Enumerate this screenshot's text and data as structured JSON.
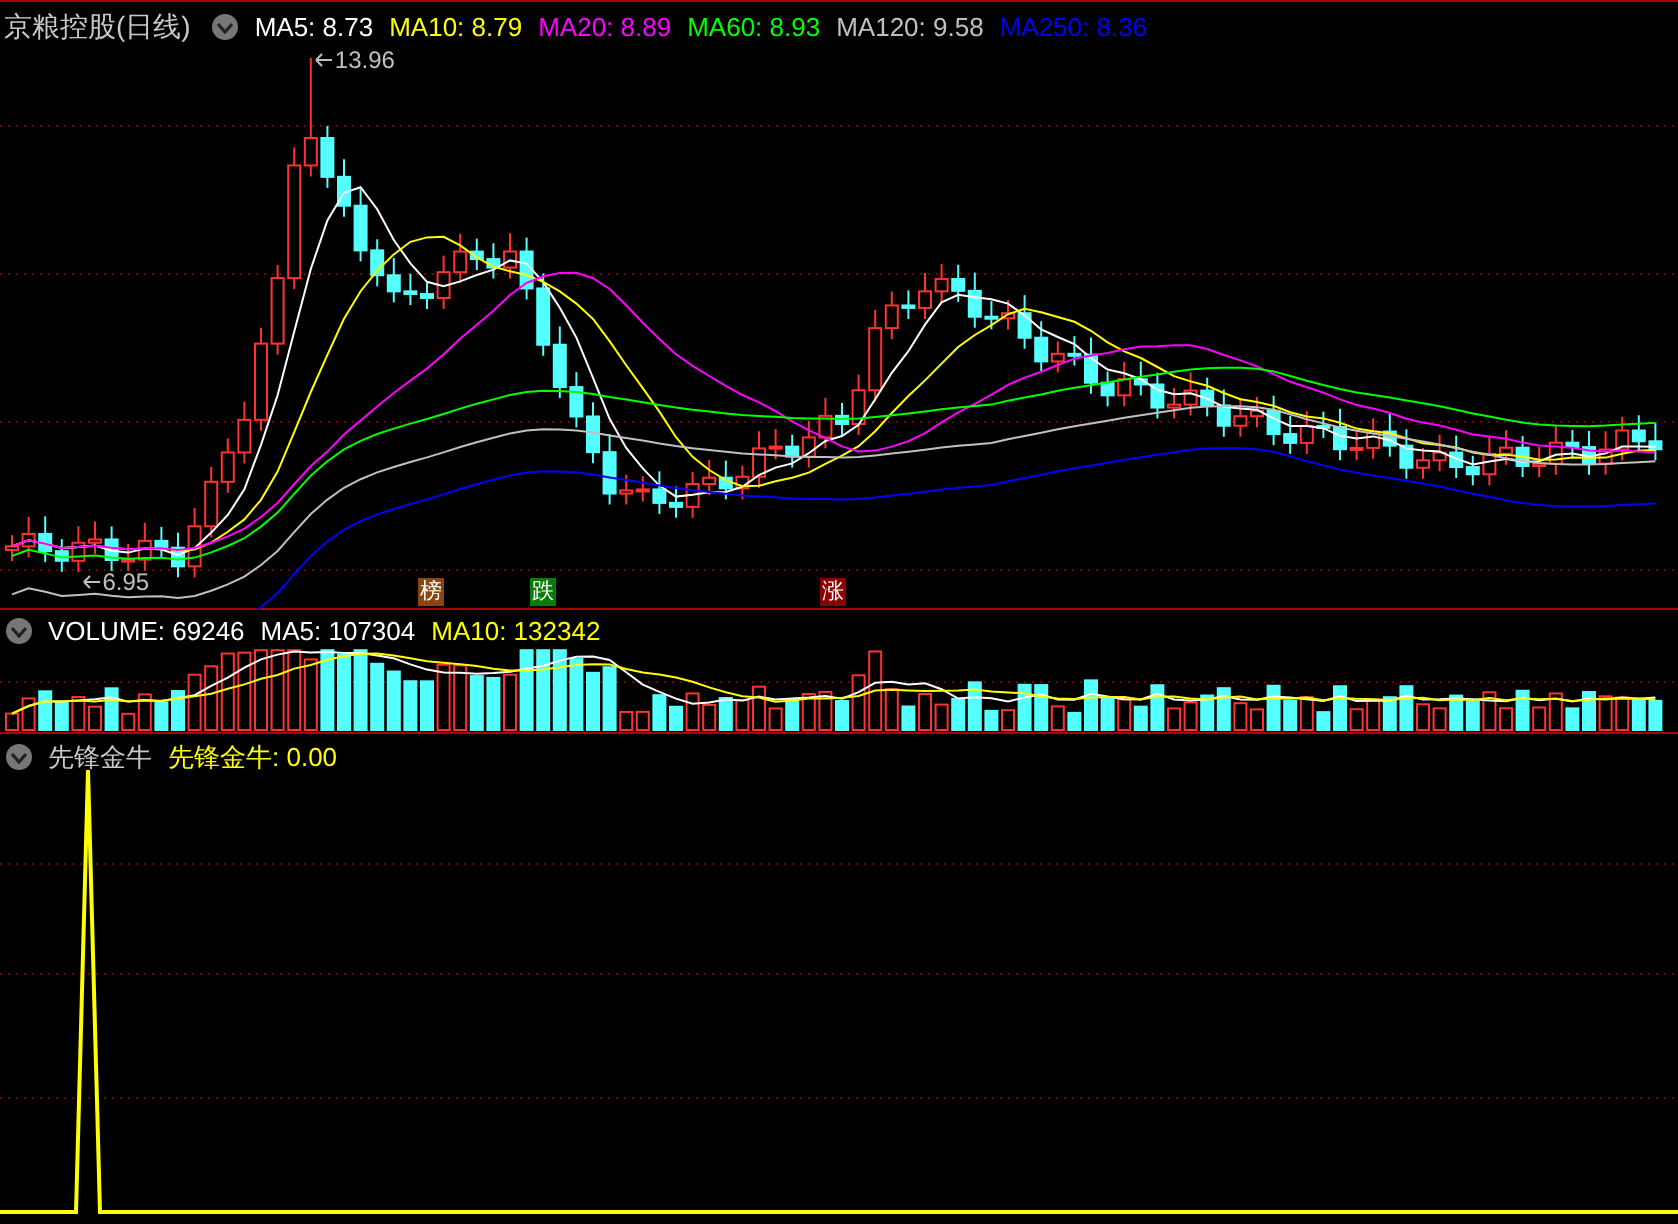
{
  "title": "京粮控股(日线)",
  "ma_legend": [
    {
      "label": "MA5:",
      "value": "8.73",
      "color": "#ffffff"
    },
    {
      "label": "MA10:",
      "value": "8.79",
      "color": "#ffff00"
    },
    {
      "label": "MA20:",
      "value": "8.89",
      "color": "#ff00ff"
    },
    {
      "label": "MA60:",
      "value": "8.93",
      "color": "#00ff00"
    },
    {
      "label": "MA120:",
      "value": "9.58",
      "color": "#c0c0c0"
    },
    {
      "label": "MA250:",
      "value": "8.36",
      "color": "#0000ff"
    }
  ],
  "price_labels": {
    "high": "13.96",
    "low": "6.95"
  },
  "markers": [
    {
      "text": "榜",
      "color": "#8b4513"
    },
    {
      "text": "跌",
      "color": "#0a7a0a"
    },
    {
      "text": "涨",
      "color": "#8b0000"
    }
  ],
  "volume": {
    "label": "VOLUME:",
    "value": "69246",
    "legend": [
      {
        "label": "MA5:",
        "value": "107304",
        "color": "#ffffff"
      },
      {
        "label": "MA10:",
        "value": "132342",
        "color": "#ffff00"
      }
    ]
  },
  "indicator": {
    "name": "先锋金牛",
    "legend": [
      {
        "label": "先锋金牛:",
        "value": "0.00",
        "color": "#ffff00"
      }
    ]
  }
}
